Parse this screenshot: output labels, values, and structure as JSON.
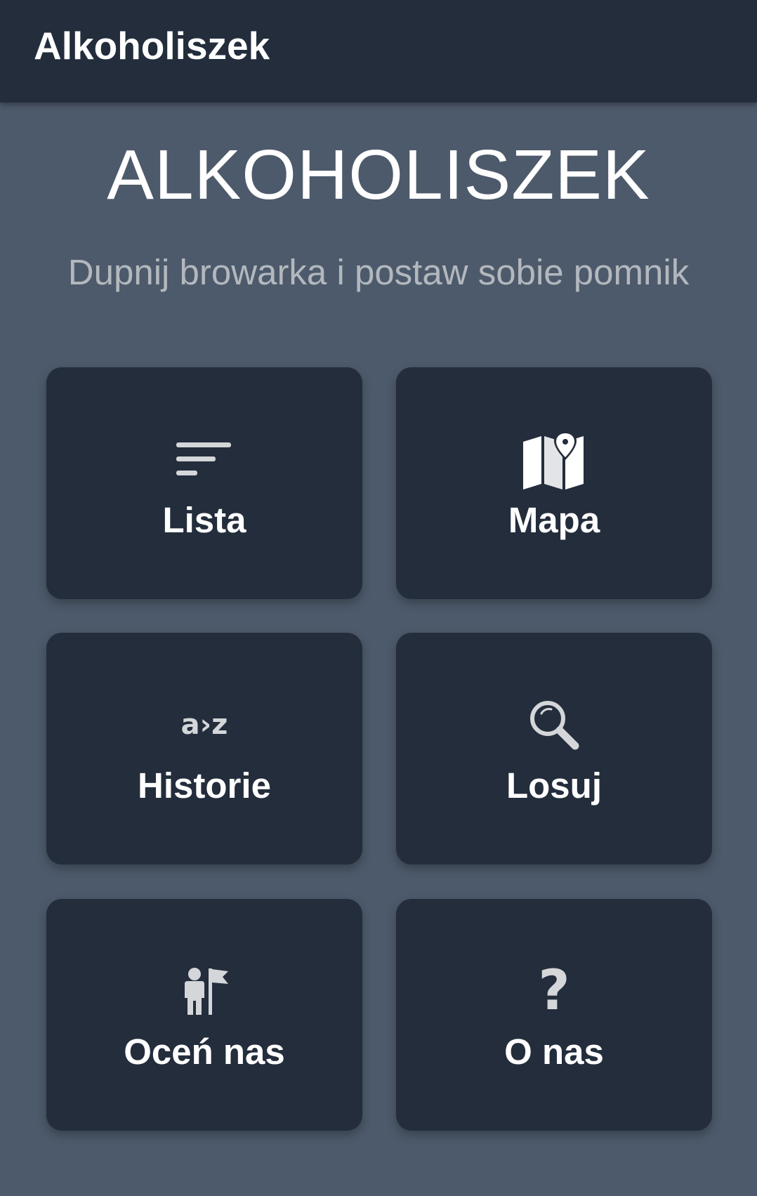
{
  "app_bar": {
    "title": "Alkoholiszek"
  },
  "hero": {
    "title": "ALKOHOLISZEK",
    "subtitle": "Dupnij browarka i postaw sobie pomnik"
  },
  "tiles": [
    {
      "label": "Lista",
      "icon": "list-lines-icon"
    },
    {
      "label": "Mapa",
      "icon": "map-pin-icon"
    },
    {
      "label": "Historie",
      "icon": "a-to-z-icon",
      "icon_text": "a›z"
    },
    {
      "label": "Losuj",
      "icon": "magnifier-icon"
    },
    {
      "label": "Oceń nas",
      "icon": "person-flag-icon"
    },
    {
      "label": "O nas",
      "icon": "question-mark-icon",
      "icon_text": "?"
    }
  ],
  "colors": {
    "app_bar": "#232d3c",
    "background": "#4d5a6b",
    "tile": "#232d3c",
    "icon": "#d4d6d9",
    "subtitle": "#b3b8be"
  }
}
